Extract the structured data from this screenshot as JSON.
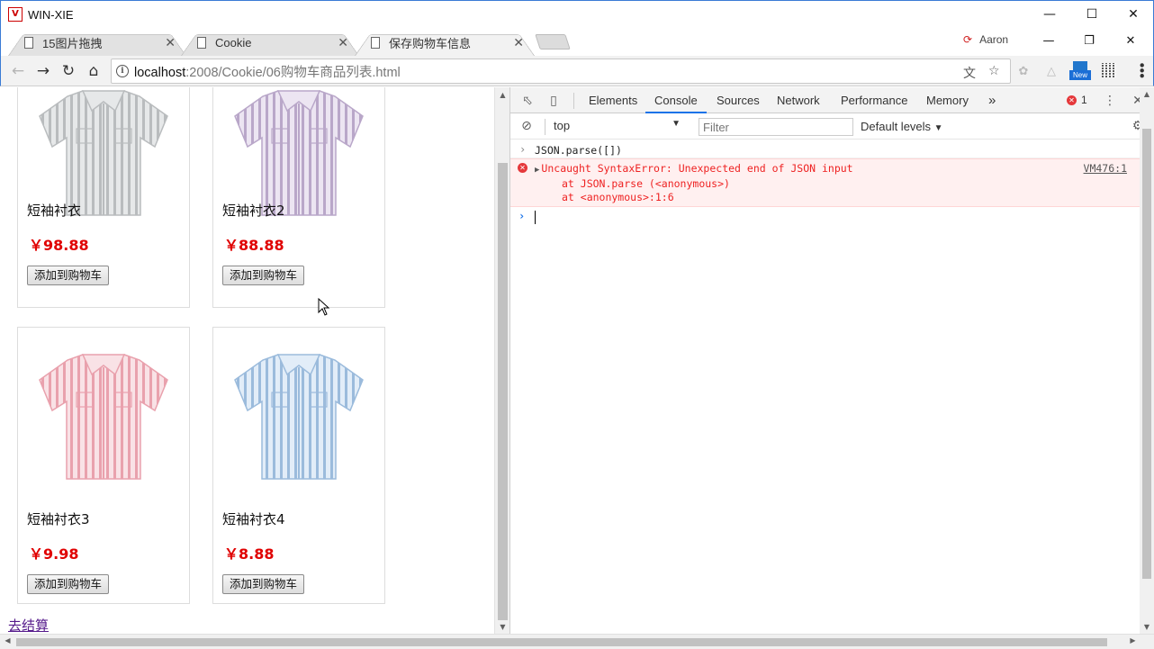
{
  "window": {
    "app_icon": "vs-code-style-logo",
    "title": "WIN-XIE",
    "controls": [
      "minimize-icon",
      "maximize-icon",
      "close-icon"
    ]
  },
  "browser": {
    "tabs": [
      {
        "label": "15图片拖拽",
        "active": false
      },
      {
        "label": "Cookie",
        "active": false
      },
      {
        "label": "保存购物车信息",
        "active": true
      }
    ],
    "profile_name": "Aaron",
    "url_host": "localhost",
    "url_path": ":2008/Cookie/06购物车商品列表.html",
    "ext_new_label": "New"
  },
  "products": [
    {
      "name": "短袖衬衣",
      "price": "￥98.88",
      "button": "添加到购物车",
      "shirt_color": "#b9bcbe",
      "stripe_color": "#e6e8e9"
    },
    {
      "name": "短袖衬衣2",
      "price": "￥88.88",
      "button": "添加到购物车",
      "shirt_color": "#b9a7c9",
      "stripe_color": "#ece5f2"
    },
    {
      "name": "短袖衬衣3",
      "price": "￥9.98",
      "button": "添加到购物车",
      "shirt_color": "#e9a1ad",
      "stripe_color": "#f9e2e6"
    },
    {
      "name": "短袖衬衣4",
      "price": "￥8.88",
      "button": "添加到购物车",
      "shirt_color": "#9bbbdc",
      "stripe_color": "#e2edf8"
    }
  ],
  "checkout_link": "去结算",
  "devtools": {
    "tabs": [
      "Elements",
      "Console",
      "Sources",
      "Network",
      "Performance",
      "Memory"
    ],
    "active_tab": "Console",
    "more_tabs": "»",
    "error_count": "1",
    "context": "top",
    "filter_placeholder": "Filter",
    "levels": "Default levels",
    "console": {
      "input": "JSON.parse([])",
      "error_message": "Uncaught SyntaxError: Unexpected end of JSON input",
      "error_source": "VM476:1",
      "stack": [
        "at JSON.parse (<anonymous>)",
        "at <anonymous>:1:6"
      ]
    }
  }
}
